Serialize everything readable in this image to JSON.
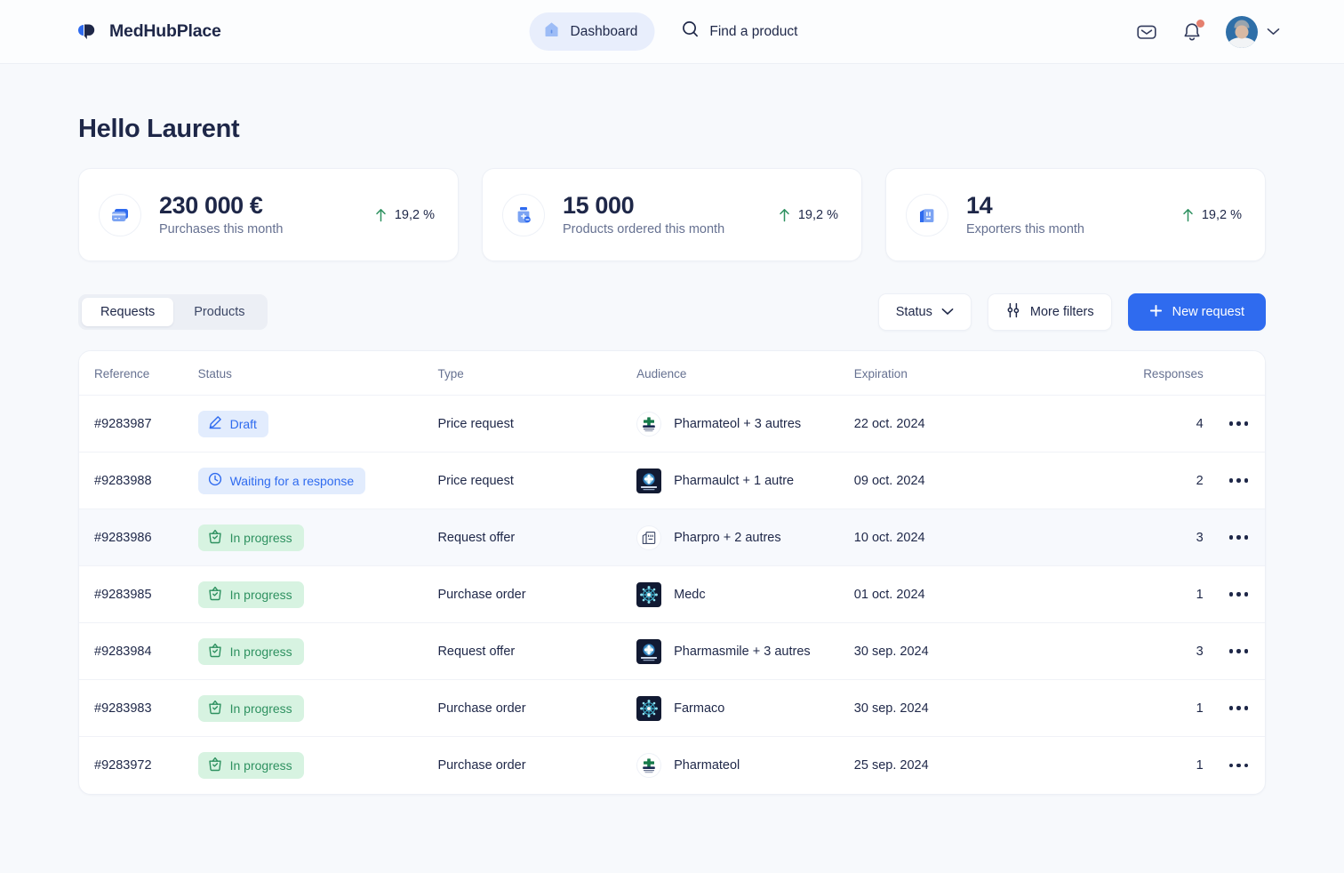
{
  "brand": {
    "name": "MedHubPlace",
    "logo_icon": "medhub-logo-icon",
    "accent": "#2f6bef"
  },
  "topbar": {
    "nav": [
      {
        "label": "Dashboard",
        "icon": "home-icon",
        "active": true
      },
      {
        "label": "Find a product",
        "icon": "search-icon",
        "active": false
      }
    ],
    "mail_icon": "mail-icon",
    "notifications_icon": "bell-icon",
    "notifications_badge": true,
    "avatar_icon": "avatar",
    "account_chevron_icon": "chevron-down-icon"
  },
  "page": {
    "greeting": "Hello Laurent"
  },
  "stats": [
    {
      "value": "230 000 €",
      "label": "Purchases this month",
      "trend": "19,2 %",
      "trend_direction": "up",
      "trend_color": "#2e9160",
      "icon": "credit-card-icon"
    },
    {
      "value": "15 000",
      "label": "Products ordered this month",
      "trend": "19,2 %",
      "trend_direction": "up",
      "trend_color": "#2e9160",
      "icon": "pill-bottle-icon"
    },
    {
      "value": "14",
      "label": "Exporters this month",
      "trend": "19,2 %",
      "trend_direction": "up",
      "trend_color": "#2e9160",
      "icon": "factory-icon"
    }
  ],
  "toolbar": {
    "tabs": [
      {
        "label": "Requests",
        "active": true
      },
      {
        "label": "Products",
        "active": false
      }
    ],
    "status_label": "Status",
    "status_icon": "chevron-down-icon",
    "more_filters_label": "More filters",
    "more_filters_icon": "sliders-icon",
    "new_request_label": "New request",
    "new_request_icon": "plus-icon"
  },
  "table": {
    "columns": [
      "Reference",
      "Status",
      "Type",
      "Audience",
      "Expiration",
      "Responses"
    ],
    "rows": [
      {
        "reference": "#9283987",
        "status": {
          "label": "Draft",
          "tone": "blue",
          "icon": "pencil-icon"
        },
        "type": "Price request",
        "audience": {
          "name": "Pharmateol + 3 autres",
          "logo": "pharmateol-logo",
          "logo_style": "light"
        },
        "expiration": "22 oct. 2024",
        "responses": "4",
        "menu_icon": "more-options-icon",
        "highlight": false
      },
      {
        "reference": "#9283988",
        "status": {
          "label": "Waiting for a response",
          "tone": "blue",
          "icon": "clock-icon"
        },
        "type": "Price request",
        "audience": {
          "name": "Pharmaulct + 1 autre",
          "logo": "pharmaulct-logo",
          "logo_style": "dark"
        },
        "expiration": "09 oct. 2024",
        "responses": "2",
        "menu_icon": "more-options-icon",
        "highlight": false
      },
      {
        "reference": "#9283986",
        "status": {
          "label": "In progress",
          "tone": "green",
          "icon": "basket-check-icon"
        },
        "type": "Request offer",
        "audience": {
          "name": "Pharpro + 2 autres",
          "logo": "pharpro-logo",
          "logo_style": "outline"
        },
        "expiration": "10 oct. 2024",
        "responses": "3",
        "menu_icon": "more-options-icon",
        "highlight": true
      },
      {
        "reference": "#9283985",
        "status": {
          "label": "In progress",
          "tone": "green",
          "icon": "basket-check-icon"
        },
        "type": "Purchase order",
        "audience": {
          "name": "Medc",
          "logo": "medc-logo",
          "logo_style": "dark"
        },
        "expiration": "01 oct. 2024",
        "responses": "1",
        "menu_icon": "more-options-icon",
        "highlight": false
      },
      {
        "reference": "#9283984",
        "status": {
          "label": "In progress",
          "tone": "green",
          "icon": "basket-check-icon"
        },
        "type": "Request offer",
        "audience": {
          "name": "Pharmasmile + 3 autres",
          "logo": "pharmasmile-logo",
          "logo_style": "dark"
        },
        "expiration": "30 sep. 2024",
        "responses": "3",
        "menu_icon": "more-options-icon",
        "highlight": false
      },
      {
        "reference": "#9283983",
        "status": {
          "label": "In progress",
          "tone": "green",
          "icon": "basket-check-icon"
        },
        "type": "Purchase order",
        "audience": {
          "name": "Farmaco",
          "logo": "farmaco-logo",
          "logo_style": "dark"
        },
        "expiration": "30 sep. 2024",
        "responses": "1",
        "menu_icon": "more-options-icon",
        "highlight": false
      },
      {
        "reference": "#9283972",
        "status": {
          "label": "In progress",
          "tone": "green",
          "icon": "basket-check-icon"
        },
        "type": "Purchase order",
        "audience": {
          "name": "Pharmateol",
          "logo": "pharmateol-logo",
          "logo_style": "light"
        },
        "expiration": "25 sep. 2024",
        "responses": "1",
        "menu_icon": "more-options-icon",
        "highlight": false
      }
    ]
  }
}
